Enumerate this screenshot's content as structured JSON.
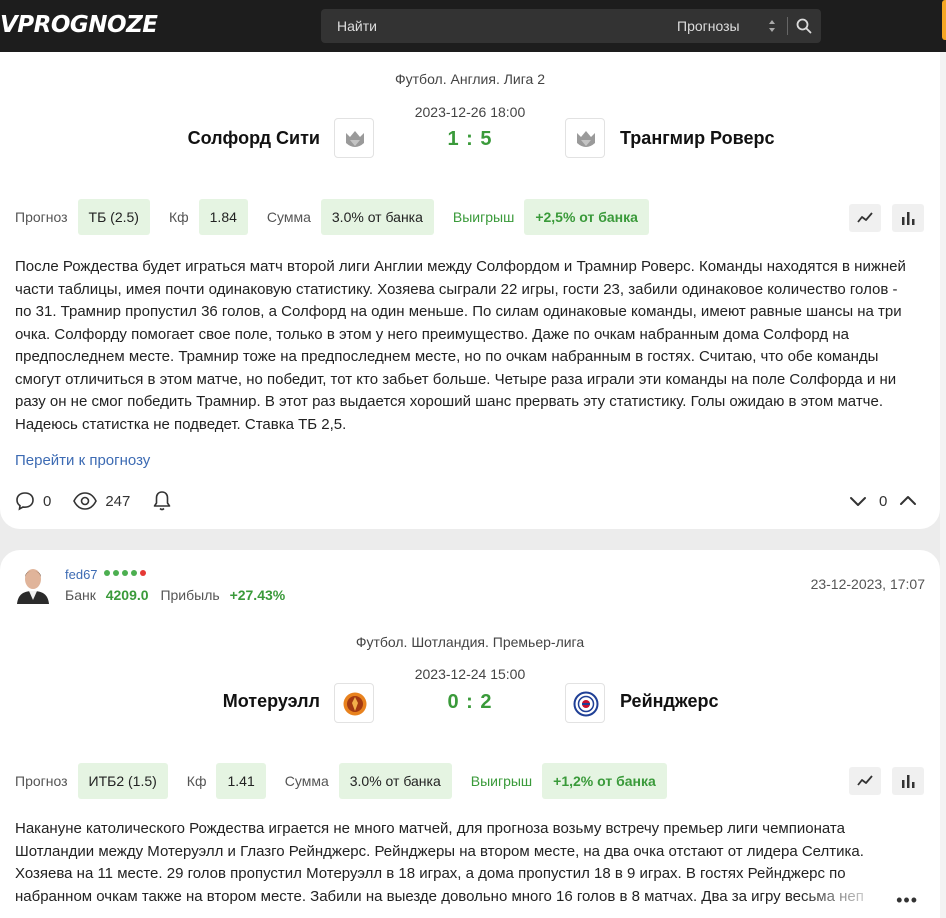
{
  "header": {
    "logo": "VPROGNOZE",
    "search_placeholder": "Найти",
    "search_category": "Прогнозы"
  },
  "posts": [
    {
      "league": "Футбол. Англия. Лига 2",
      "datetime": "2023-12-26 18:00",
      "home_team": "Солфорд Сити",
      "away_team": "Трангмир Роверс",
      "score": "1 : 5",
      "prognoz_label": "Прогноз",
      "prognoz_value": "ТБ (2.5)",
      "kf_label": "Кф",
      "kf_value": "1.84",
      "summa_label": "Сумма",
      "summa_value": "3.0% от банка",
      "win_label": "Выигрыш",
      "win_value": "+2,5% от банка",
      "text": [
        "После Рождества будет играться матч второй лиги Англии между Солфордом и Трамнир Роверс. Команды находятся в нижней",
        "части таблицы, имея почти одинаковую статистику. Хозяева сыграли 22 игры, гости 23, забили одинаковое количество голов -",
        "по 31. Трамнир пропустил 36 голов, а Солфорд на один меньше. По силам одинаковые команды, имеют равные шансы на три",
        "очка. Солфорду помогает свое поле, только в этом у него преимущество. Даже по очкам набранным дома Солфорд на",
        "предпоследнем месте. Трамнир тоже на предпоследнем месте, но по очкам набранным в гостях. Считаю, что обе команды",
        "смогут отличиться в этом матче, но победит, тот кто забьет больше. Четыре раза играли эти команды на поле Солфорда и ни",
        "разу он не смог победить Трамнир. В этот раз выдается хороший шанс прервать эту статистику. Голы ожидаю в этом матче.",
        "Надеюсь статистка не подведет. Ставка ТБ 2,5."
      ],
      "link": "Перейти к прогнозу",
      "comments": "0",
      "views": "247",
      "votes": "0"
    },
    {
      "author": "fed67",
      "bank_label": "Банк",
      "bank_value": "4209.0",
      "profit_label": "Прибыль",
      "profit_value": "+27.43%",
      "post_date": "23-12-2023, 17:07",
      "league": "Футбол. Шотландия. Премьер-лига",
      "datetime": "2023-12-24 15:00",
      "home_team": "Мотеруэлл",
      "away_team": "Рейнджерс",
      "score": "0 : 2",
      "prognoz_label": "Прогноз",
      "prognoz_value": "ИТБ2 (1.5)",
      "kf_label": "Кф",
      "kf_value": "1.41",
      "summa_label": "Сумма",
      "summa_value": "3.0% от банка",
      "win_label": "Выигрыш",
      "win_value": "+1,2% от банка",
      "text": [
        "Накануне католического Рождества играется не много матчей, для прогноза возьму встречу премьер лиги чемпионата",
        "Шотландии между Мотеруэлл и Глазго Рейнджерс. Рейнджеры на втором месте, на два очка отстают от лидера Селтика.",
        "Хозяева на 11 месте. 29 голов пропустил Мотеруэлл в 18 играх, а дома пропустил 18 в 9 играх. В гостях Рейнджерс по",
        "набранном очкам также на втором месте. Забили на выезде довольно много 16 голов в 8 матчах. Два за игру весьма неп"
      ],
      "more": "•••"
    }
  ]
}
